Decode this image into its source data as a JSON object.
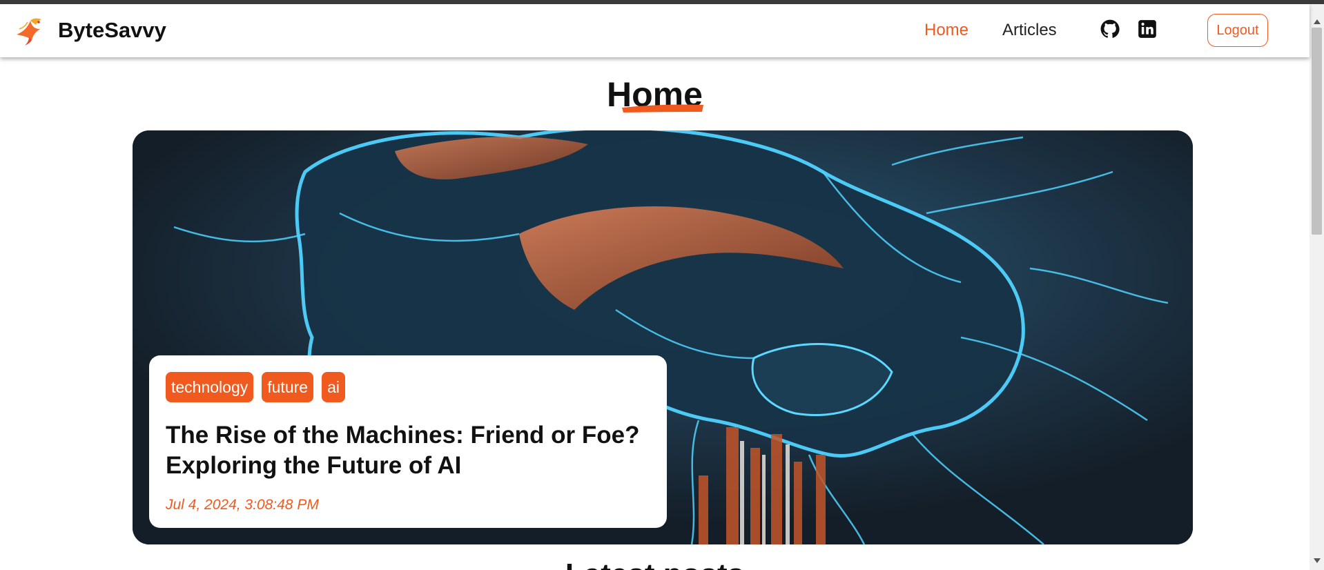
{
  "brand": {
    "name": "ByteSavvy",
    "logo_icon": "phoenix-bird-icon"
  },
  "nav": {
    "links": [
      {
        "label": "Home",
        "active": true
      },
      {
        "label": "Articles",
        "active": false
      }
    ],
    "icons": [
      "github-icon",
      "linkedin-icon"
    ],
    "logout_label": "Logout"
  },
  "page": {
    "title": "Home"
  },
  "hero": {
    "tags": [
      "technology",
      "future",
      "ai"
    ],
    "title": "The Rise of the Machines: Friend or Foe? Exploring the Future of AI",
    "date": "Jul 4, 2024, 3:08:48 PM",
    "image_subject": "glowing blue neural head with orange circuitry"
  },
  "next_section": {
    "title": "Latest posts"
  },
  "colors": {
    "accent": "#f05a1e",
    "hero_bg": "#1a2532",
    "neon": "#2fb8e6"
  }
}
